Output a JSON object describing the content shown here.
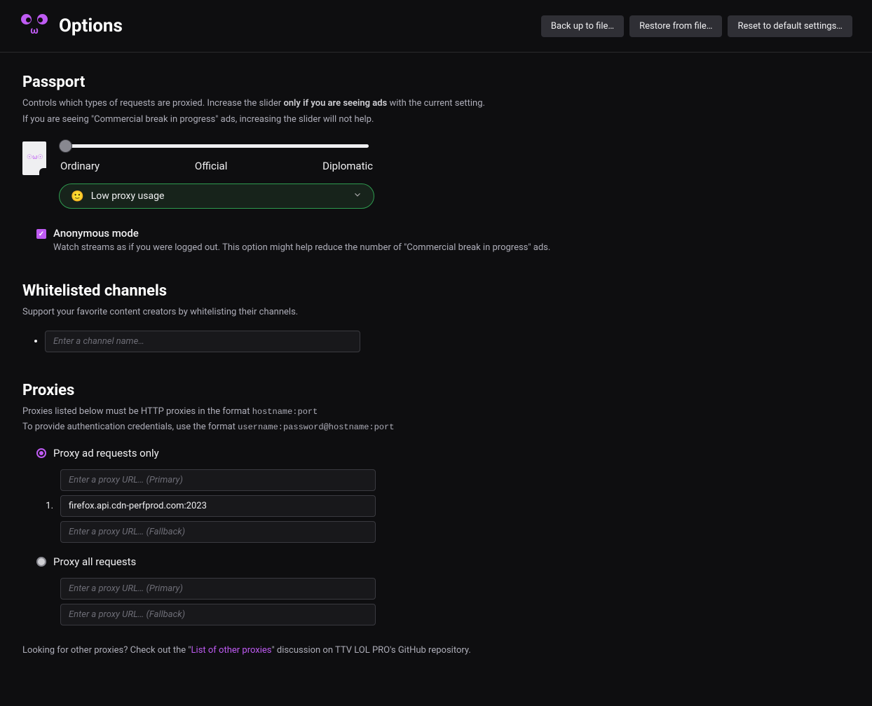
{
  "header": {
    "title": "Options",
    "buttons": {
      "backup": "Back up to file…",
      "restore": "Restore from file…",
      "reset": "Reset to default settings…"
    }
  },
  "passport": {
    "heading": "Passport",
    "desc_prefix": "Controls which types of requests are proxied. Increase the slider ",
    "desc_bold": "only if you are seeing ads",
    "desc_suffix": " with the current setting.",
    "desc_line2": "If you are seeing \"Commercial break in progress\" ads, increasing the slider will not help.",
    "slider": {
      "labels": [
        "Ordinary",
        "Official",
        "Diplomatic"
      ]
    },
    "usage": {
      "emoji": "🙂",
      "text": "Low proxy usage"
    },
    "anonymous": {
      "title": "Anonymous mode",
      "desc": "Watch streams as if you were logged out. This option might help reduce the number of \"Commercial break in progress\" ads.",
      "checked": true
    }
  },
  "whitelist": {
    "heading": "Whitelisted channels",
    "desc": "Support your favorite content creators by whitelisting their channels.",
    "placeholder": "Enter a channel name…"
  },
  "proxies": {
    "heading": "Proxies",
    "desc1_prefix": "Proxies listed below must be HTTP proxies in the format ",
    "desc1_code": "hostname:port",
    "desc2_prefix": "To provide authentication credentials, use the format ",
    "desc2_code": "username:password@hostname:port",
    "ad_only": {
      "label": "Proxy ad requests only",
      "selected": true,
      "primary_placeholder": "Enter a proxy URL… (Primary)",
      "entries": [
        "firefox.api.cdn-perfprod.com:2023"
      ],
      "fallback_placeholder": "Enter a proxy URL… (Fallback)"
    },
    "all": {
      "label": "Proxy all requests",
      "selected": false,
      "primary_placeholder": "Enter a proxy URL… (Primary)",
      "fallback_placeholder": "Enter a proxy URL… (Fallback)"
    }
  },
  "footer": {
    "prefix": "Looking for other proxies? Check out the \"",
    "link": "List of other proxies",
    "suffix": "\" discussion on TTV LOL PRO's GitHub repository."
  }
}
